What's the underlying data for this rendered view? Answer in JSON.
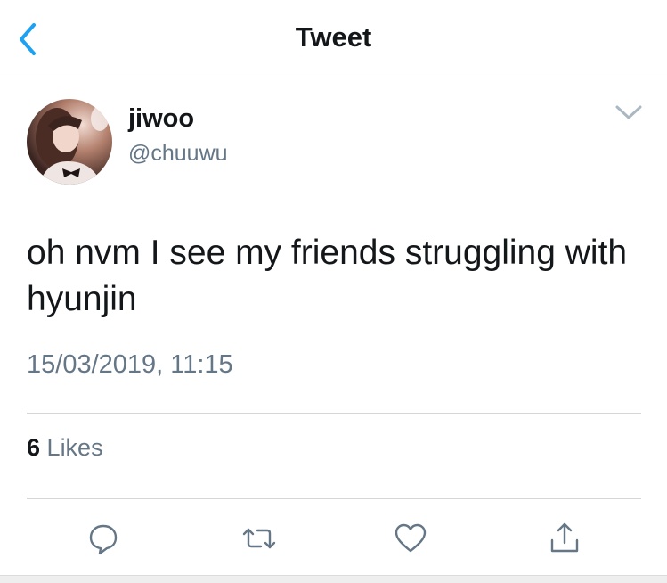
{
  "header": {
    "title": "Tweet",
    "back_icon": "chevron-left-icon",
    "accent_color": "#1DA1F2"
  },
  "tweet": {
    "author": {
      "display_name": "jiwoo",
      "handle": "@chuuwu",
      "avatar": "profile-photo"
    },
    "menu_icon": "chevron-down-icon",
    "text": "oh nvm I see my friends struggling with hyunjin",
    "timestamp": "15/03/2019, 11:15",
    "likes": {
      "count": "6",
      "label": "Likes"
    }
  },
  "actions": [
    {
      "name": "reply",
      "icon": "reply-icon"
    },
    {
      "name": "retweet",
      "icon": "retweet-icon"
    },
    {
      "name": "like",
      "icon": "heart-icon"
    },
    {
      "name": "share",
      "icon": "share-icon"
    }
  ],
  "colors": {
    "text": "#14171A",
    "secondary": "#657786",
    "divider": "#D6D6D6"
  }
}
